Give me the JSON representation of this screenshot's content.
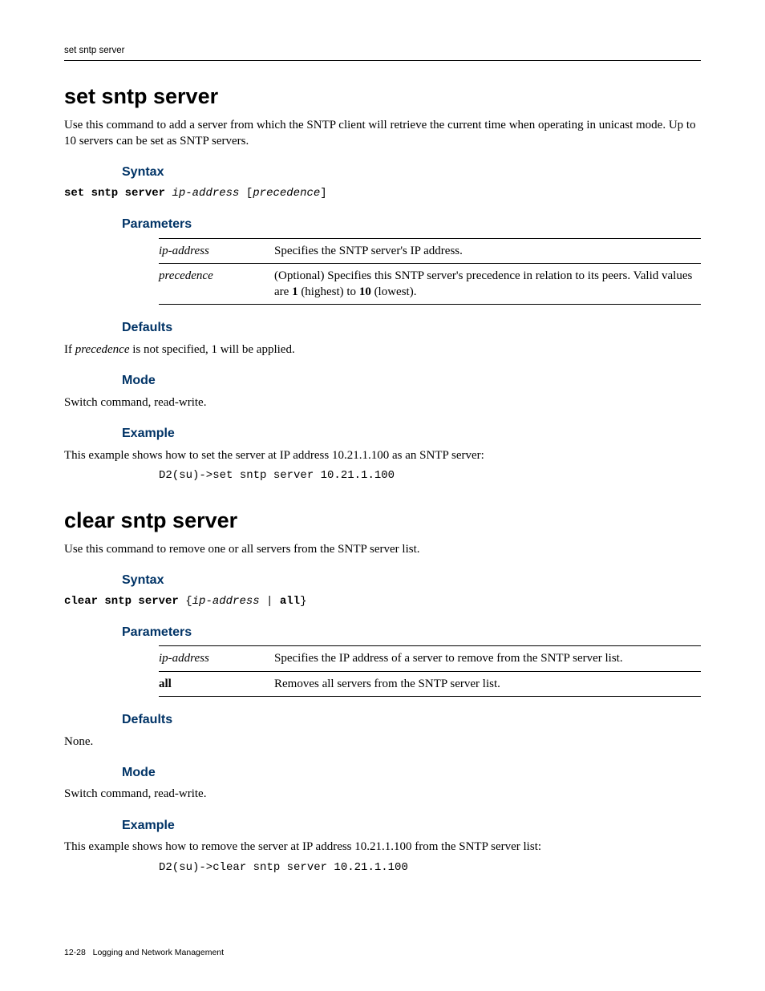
{
  "running_head": "set sntp server",
  "footer": {
    "page": "12-28",
    "chapter": "Logging and Network Management"
  },
  "cmd1": {
    "title": "set sntp server",
    "intro": "Use this command to add a server from which the SNTP client will retrieve the current time when operating in unicast mode. Up to 10 servers can be set as SNTP servers.",
    "syntax_heading": "Syntax",
    "syntax_kw": "set sntp server",
    "syntax_arg1": "ip-address",
    "syntax_arg2_open": " [",
    "syntax_arg2": "precedence",
    "syntax_arg2_close": "]",
    "params_heading": "Parameters",
    "params": [
      {
        "name": "ip-address",
        "bold": false,
        "desc": "Specifies the SNTP server's IP address."
      },
      {
        "name": "precedence",
        "bold": false,
        "desc_html": "(Optional) Specifies this SNTP server's precedence in relation to its peers. Valid values are <b>1</b> (highest) to <b>10</b> (lowest)."
      }
    ],
    "defaults_heading": "Defaults",
    "defaults_html": "If <i>precedence</i> is not specified, 1 will be applied.",
    "mode_heading": "Mode",
    "mode_text": "Switch command, read-write.",
    "example_heading": "Example",
    "example_intro": "This example shows how to set the server at IP address 10.21.1.100  as an  SNTP server:",
    "example_cmd": "D2(su)->set sntp server 10.21.1.100"
  },
  "cmd2": {
    "title": "clear sntp server",
    "intro": "Use this command to remove one or all servers from the SNTP server list.",
    "syntax_heading": "Syntax",
    "syntax_kw": "clear sntp server",
    "syntax_open": " {",
    "syntax_arg1": "ip-address",
    "syntax_sep": " | ",
    "syntax_arg2kw": "all",
    "syntax_close": "}",
    "params_heading": "Parameters",
    "params": [
      {
        "name": "ip-address",
        "bold": false,
        "desc": "Specifies the IP address of a server to remove from the SNTP server list."
      },
      {
        "name": "all",
        "bold": true,
        "desc": "Removes all servers from the SNTP server list."
      }
    ],
    "defaults_heading": "Defaults",
    "defaults_text": "None.",
    "mode_heading": "Mode",
    "mode_text": "Switch command, read-write.",
    "example_heading": "Example",
    "example_intro": "This example shows how to remove the server at IP address 10.21.1.100  from the SNTP server list:",
    "example_cmd": "D2(su)->clear sntp server 10.21.1.100"
  }
}
